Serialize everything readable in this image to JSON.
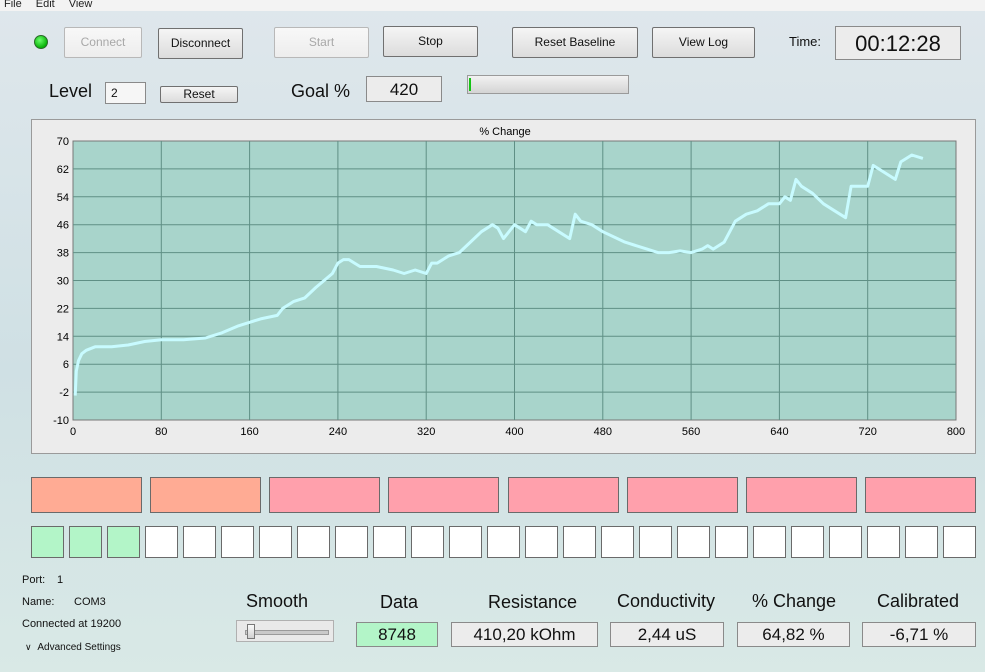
{
  "menu": [
    "File",
    "Edit",
    "View"
  ],
  "toolbar": {
    "connect": "Connect",
    "disconnect": "Disconnect",
    "start": "Start",
    "stop": "Stop",
    "reset_baseline": "Reset Baseline",
    "view_log": "View Log",
    "time_label": "Time:",
    "time_value": "00:12:28",
    "status_led_color": "#09b309"
  },
  "level": {
    "label": "Level",
    "value": "2",
    "reset": "Reset"
  },
  "goal": {
    "label": "Goal %",
    "value": "420",
    "progress": 0.01
  },
  "chart_data": {
    "type": "line",
    "title": "% Change",
    "xlim": [
      0,
      800
    ],
    "ylim": [
      -10,
      70
    ],
    "xticks": [
      "0",
      "80",
      "160",
      "240",
      "320",
      "400",
      "480",
      "560",
      "640",
      "720",
      "800"
    ],
    "yticks": [
      "70",
      "62",
      "54",
      "46",
      "38",
      "30",
      "22",
      "14",
      "6",
      "-2",
      "-10"
    ],
    "grid": true,
    "background": "#a8d4cb",
    "line_color": "#c8fbff",
    "series": [
      {
        "x": [
          2,
          3,
          5,
          8,
          12,
          20,
          35,
          50,
          65,
          80,
          100,
          120,
          135,
          150,
          160,
          170,
          185,
          190,
          200,
          210,
          220,
          235,
          240,
          245,
          250,
          255,
          260,
          275,
          290,
          300,
          310,
          320,
          325,
          330,
          340,
          350,
          360,
          370,
          380,
          385,
          390,
          400,
          405,
          410,
          415,
          420,
          430,
          440,
          450,
          455,
          460,
          470,
          480,
          500,
          520,
          530,
          540,
          550,
          560,
          570,
          575,
          580,
          590,
          600,
          610,
          620,
          630,
          640,
          645,
          650,
          655,
          660,
          670,
          680,
          690,
          700,
          705,
          710,
          720,
          725,
          730,
          740,
          745,
          750,
          760,
          770
        ],
        "y": [
          -3,
          4,
          7,
          9,
          10,
          11,
          11,
          11.5,
          12.5,
          13,
          13,
          13.5,
          15,
          17,
          18,
          19,
          20,
          22,
          24,
          25,
          28,
          32,
          35,
          36,
          36,
          35,
          34,
          34,
          33,
          32,
          33,
          32,
          35,
          35,
          37,
          38,
          41,
          44,
          46,
          45,
          42,
          46,
          45,
          44,
          47,
          46,
          46,
          44,
          42,
          49,
          47,
          46,
          44,
          41,
          39,
          38,
          38,
          38.5,
          38,
          39,
          40,
          39,
          41,
          47,
          49,
          50,
          52,
          52,
          54,
          53,
          59,
          57,
          55,
          52,
          50,
          48,
          57,
          57,
          57,
          63,
          62,
          60,
          59,
          64,
          66,
          65
        ]
      }
    ]
  },
  "segments_top": [
    {
      "color": "#ffab94"
    },
    {
      "color": "#ffab94"
    },
    {
      "color": "#ffa0ac"
    },
    {
      "color": "#ffa0ac"
    },
    {
      "color": "#ffa0ac"
    },
    {
      "color": "#ffa0ac"
    },
    {
      "color": "#ffa0ac"
    },
    {
      "color": "#ffa0ac"
    }
  ],
  "segments_bottom_filled": 3,
  "segments_bottom_count": 25,
  "segment_fill_color": "#b3f5c8",
  "port": {
    "port_label": "Port:",
    "port_value": "1",
    "name_label": "Name:",
    "name_value": "COM3",
    "status": "Connected at 19200",
    "advanced": "Advanced Settings"
  },
  "smooth": {
    "label": "Smooth",
    "level": 0.05
  },
  "readouts": {
    "data_label": "Data",
    "data_value": "8748",
    "resistance_label": "Resistance",
    "resistance_value": "410,20 kOhm",
    "conductivity_label": "Conductivity",
    "conductivity_value": "2,44 uS",
    "change_label": "% Change",
    "change_value": "64,82 %",
    "calibrated_label": "Calibrated",
    "calibrated_value": "-6,71 %"
  }
}
